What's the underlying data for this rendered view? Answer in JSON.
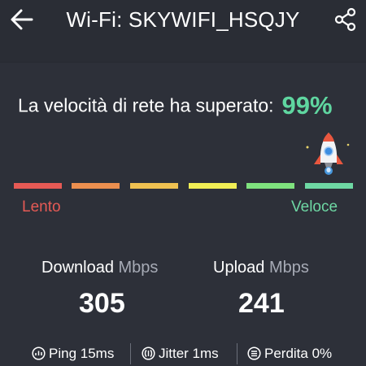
{
  "header": {
    "title": "Wi-Fi: SKYWIFI_HSQJY",
    "back_icon": "arrow-left-icon",
    "share_icon": "share-icon"
  },
  "result": {
    "text": "La velocità di rete ha superato:",
    "value": "99%"
  },
  "speed_scale": {
    "slow_label": "Lento",
    "fast_label": "Veloce",
    "colors": [
      "#e65a55",
      "#eb8f4f",
      "#efc151",
      "#f1ee55",
      "#7fe27e",
      "#6ed8a4"
    ],
    "level": 1.0
  },
  "metrics": {
    "download_label": "Download",
    "download_unit": "Mbps",
    "download_value": "305",
    "upload_label": "Upload",
    "upload_unit": "Mbps",
    "upload_value": "241"
  },
  "footer": {
    "ping": "Ping 15ms",
    "jitter": "Jitter 1ms",
    "loss": "Perdita 0%"
  },
  "colors": {
    "background": "#2d3039",
    "accent": "#5fd6a0",
    "slow": "#e65a55"
  }
}
